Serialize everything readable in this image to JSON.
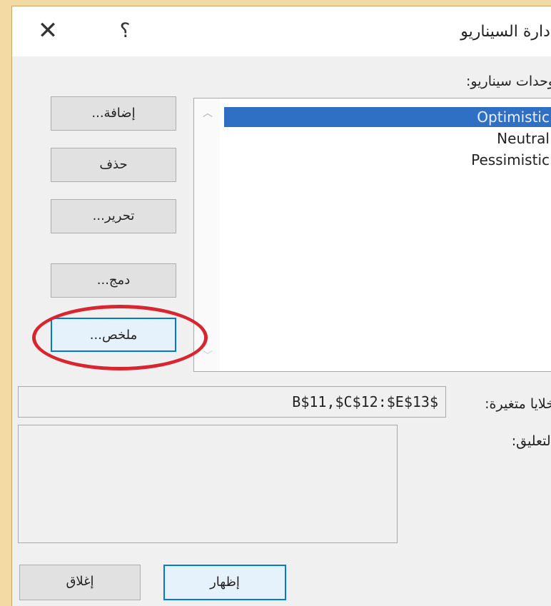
{
  "window": {
    "title": "إدارة السيناريو",
    "close_glyph": "✕",
    "help_glyph": "؟"
  },
  "scenarios": {
    "label": "وحدات سيناريو:",
    "items": [
      "Optimistic",
      "Neutral",
      "Pessimistic"
    ],
    "selected": "Optimistic"
  },
  "buttons": {
    "add": "إضافة...",
    "delete": "حذف",
    "edit": "تحرير...",
    "merge": "دمج...",
    "summary": "ملخص..."
  },
  "changing_cells": {
    "label": "خلايا متغيرة:",
    "value": "B$11,$C$12:$E$13$"
  },
  "comment": {
    "label": "التعليق:",
    "value": ""
  },
  "footer": {
    "show": "إظهار",
    "close": "إغلاق"
  },
  "colors": {
    "selection": "#2f6fc4",
    "highlight_circle": "#d9252f",
    "background": "#f3d9a4"
  },
  "icons": {
    "scroll_up": "chevron-up-icon",
    "scroll_down": "chevron-down-icon"
  }
}
